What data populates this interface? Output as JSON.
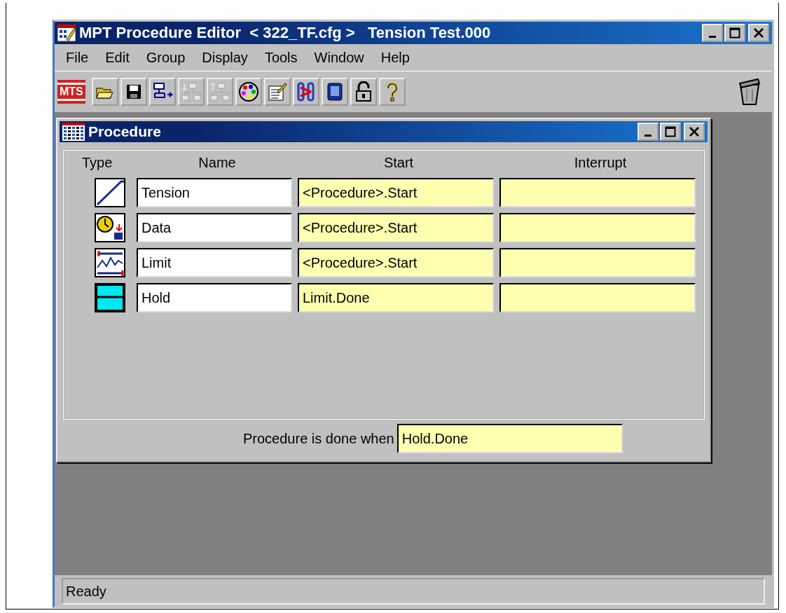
{
  "window": {
    "title": "MPT Procedure Editor  < 322_TF.cfg >   Tension Test.000"
  },
  "menu": [
    "File",
    "Edit",
    "Group",
    "Display",
    "Tools",
    "Window",
    "Help"
  ],
  "toolbar": {
    "logo": "MTS",
    "tools": [
      {
        "kind": "open",
        "disabled": false
      },
      {
        "kind": "save",
        "disabled": false
      },
      {
        "kind": "flow",
        "disabled": false
      },
      {
        "kind": "insert-before",
        "disabled": true
      },
      {
        "kind": "insert-after",
        "disabled": true
      },
      {
        "kind": "palette",
        "disabled": false
      },
      {
        "kind": "edit",
        "disabled": false
      },
      {
        "kind": "link",
        "disabled": false
      },
      {
        "kind": "device",
        "disabled": false
      },
      {
        "kind": "lock",
        "disabled": false
      },
      {
        "kind": "help",
        "disabled": false
      }
    ]
  },
  "procedure_window": {
    "title": "Procedure",
    "columns": [
      "Type",
      "Name",
      "Start",
      "Interrupt"
    ],
    "rows": [
      {
        "kind": "ramp",
        "name": "Tension",
        "start": "<Procedure>.Start",
        "interrupt": ""
      },
      {
        "kind": "data",
        "name": "Data",
        "start": "<Procedure>.Start",
        "interrupt": ""
      },
      {
        "kind": "limit",
        "name": "Limit",
        "start": "<Procedure>.Start",
        "interrupt": ""
      },
      {
        "kind": "hold",
        "name": "Hold",
        "start": "Limit.Done",
        "interrupt": ""
      }
    ],
    "done_label": "Procedure is done when",
    "done_value": "Hold.Done"
  },
  "status_bar": "Ready"
}
